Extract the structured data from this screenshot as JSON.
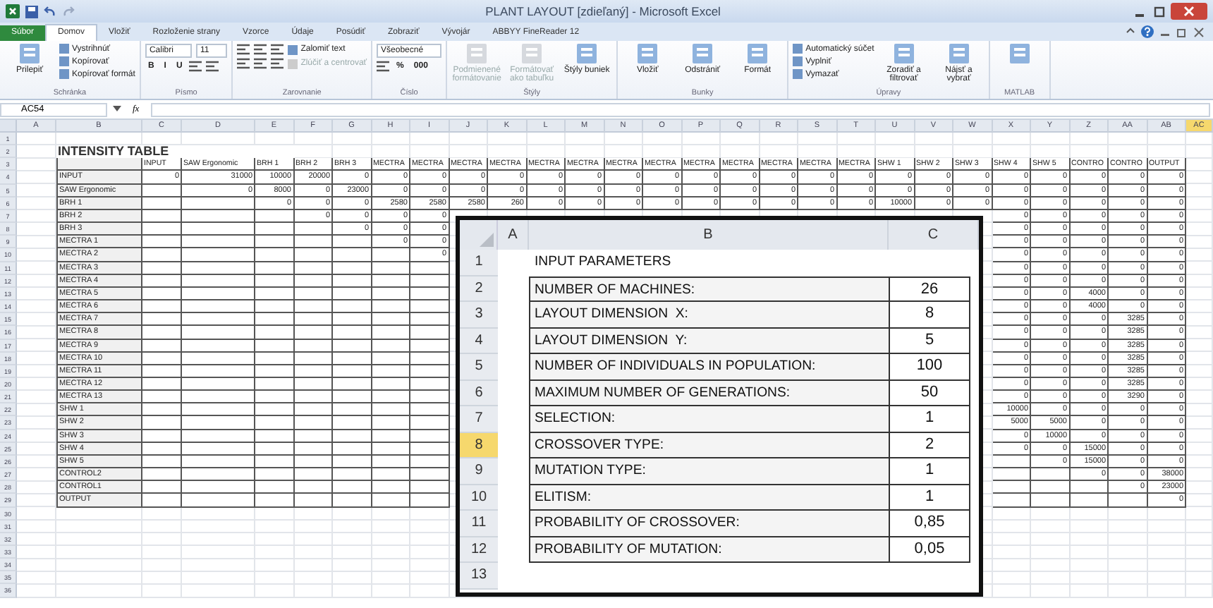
{
  "window": {
    "title": "PLANT LAYOUT [zdieľaný] - Microsoft Excel"
  },
  "tabs": [
    {
      "label": "Súbor",
      "kind": "file",
      "selected": false
    },
    {
      "label": "Domov",
      "kind": "tab",
      "selected": true
    },
    {
      "label": "Vložiť",
      "kind": "tab",
      "selected": false
    },
    {
      "label": "Rozloženie strany",
      "kind": "tab",
      "selected": false
    },
    {
      "label": "Vzorce",
      "kind": "tab",
      "selected": false
    },
    {
      "label": "Údaje",
      "kind": "tab",
      "selected": false
    },
    {
      "label": "Posúdiť",
      "kind": "tab",
      "selected": false
    },
    {
      "label": "Zobraziť",
      "kind": "tab",
      "selected": false
    },
    {
      "label": "Vývojár",
      "kind": "tab",
      "selected": false
    },
    {
      "label": "ABBYY FineReader 12",
      "kind": "tab",
      "selected": false
    }
  ],
  "ribbon": {
    "groups": [
      {
        "label": "Schránka",
        "big": [
          {
            "kind": "big",
            "text": "Prilepiť",
            "disabled": false
          }
        ],
        "stack": [
          {
            "kind": "small",
            "text": "Vystrihnúť",
            "disabled": false
          },
          {
            "kind": "small",
            "text": "Kopírovať",
            "disabled": false
          },
          {
            "kind": "small",
            "text": "Kopírovať formát",
            "disabled": false
          }
        ]
      },
      {
        "label": "Písmo",
        "font_controls": [
          {
            "kind": "field",
            "text": "Calibri",
            "disabled": false
          },
          {
            "kind": "field",
            "text": "11",
            "disabled": false
          },
          {
            "kind": "glyph",
            "text": "B",
            "disabled": false
          },
          {
            "kind": "glyph",
            "text": "I",
            "disabled": false
          },
          {
            "kind": "glyph",
            "text": "U",
            "disabled": false
          },
          {
            "kind": "icon",
            "disabled": false
          },
          {
            "kind": "icon",
            "disabled": false
          }
        ]
      },
      {
        "label": "Zarovnanie",
        "font_controls": [
          {
            "kind": "icon",
            "disabled": false
          },
          {
            "kind": "icon",
            "disabled": false
          },
          {
            "kind": "icon",
            "disabled": false
          },
          {
            "kind": "small",
            "text": "Zalomiť text",
            "disabled": false
          },
          {
            "kind": "icon",
            "disabled": false
          },
          {
            "kind": "icon",
            "disabled": false
          },
          {
            "kind": "icon",
            "disabled": false
          },
          {
            "kind": "small",
            "text": "Zlúčiť a centrovať",
            "disabled": true
          }
        ]
      },
      {
        "label": "Číslo",
        "font_controls": [
          {
            "kind": "field",
            "text": "Všeobecné",
            "disabled": false
          },
          {
            "kind": "icon",
            "disabled": false
          },
          {
            "kind": "glyph",
            "text": "%",
            "disabled": false
          },
          {
            "kind": "glyph",
            "text": "000",
            "disabled": false
          }
        ]
      },
      {
        "label": "Štýly",
        "big": [
          {
            "kind": "big",
            "text": "Podmienené formátovanie",
            "disabled": true
          },
          {
            "kind": "big",
            "text": "Formátovať ako tabuľku",
            "disabled": true
          },
          {
            "kind": "big",
            "text": "Štýly buniek",
            "disabled": false
          }
        ]
      },
      {
        "label": "Bunky",
        "big": [
          {
            "kind": "big",
            "text": "Vložiť",
            "disabled": false
          },
          {
            "kind": "big",
            "text": "Odstrániť",
            "disabled": false
          },
          {
            "kind": "big",
            "text": "Formát",
            "disabled": false
          }
        ]
      },
      {
        "label": "Úpravy",
        "stack": [
          {
            "kind": "small",
            "text": "Automatický súčet",
            "disabled": false
          },
          {
            "kind": "small",
            "text": "Vyplniť",
            "disabled": false
          },
          {
            "kind": "small",
            "text": "Vymazať",
            "disabled": false
          }
        ],
        "big_after": [
          {
            "kind": "big",
            "text": "Zoradiť a filtrovať",
            "disabled": false
          },
          {
            "kind": "big",
            "text": "Nájsť a vybrať",
            "disabled": false
          }
        ]
      },
      {
        "label": "MATLAB",
        "big": [
          {
            "kind": "big",
            "disabled": false
          }
        ]
      }
    ]
  },
  "formula_bar": {
    "name_box": "AC54",
    "function_label": "fx"
  },
  "sheet": {
    "column_letters": [
      {
        "label": "A",
        "selected": false
      },
      {
        "label": "B",
        "selected": false
      },
      {
        "label": "C",
        "selected": false
      },
      {
        "label": "D",
        "selected": false
      },
      {
        "label": "E",
        "selected": false
      },
      {
        "label": "F",
        "selected": false
      },
      {
        "label": "G",
        "selected": false
      },
      {
        "label": "H",
        "selected": false
      },
      {
        "label": "I",
        "selected": false
      },
      {
        "label": "J",
        "selected": false
      },
      {
        "label": "K",
        "selected": false
      },
      {
        "label": "L",
        "selected": false
      },
      {
        "label": "M",
        "selected": false
      },
      {
        "label": "N",
        "selected": false
      },
      {
        "label": "O",
        "selected": false
      },
      {
        "label": "P",
        "selected": false
      },
      {
        "label": "Q",
        "selected": false
      },
      {
        "label": "R",
        "selected": false
      },
      {
        "label": "S",
        "selected": false
      },
      {
        "label": "T",
        "selected": false
      },
      {
        "label": "U",
        "selected": false
      },
      {
        "label": "V",
        "selected": false
      },
      {
        "label": "W",
        "selected": false
      },
      {
        "label": "X",
        "selected": false
      },
      {
        "label": "Y",
        "selected": false
      },
      {
        "label": "Z",
        "selected": false
      },
      {
        "label": "AA",
        "selected": false
      },
      {
        "label": "AB",
        "selected": false
      },
      {
        "label": "AC",
        "selected": true
      }
    ],
    "row_numbers": [
      "1",
      "2",
      "3",
      "4",
      "5",
      "6",
      "7",
      "8",
      "9",
      "10",
      "11",
      "12",
      "13",
      "14",
      "15",
      "16",
      "17",
      "18",
      "19",
      "20",
      "21",
      "22",
      "23",
      "24",
      "25",
      "26",
      "27",
      "28",
      "29",
      "30",
      "31",
      "32",
      "33",
      "34",
      "35",
      "36"
    ],
    "intensity_table": {
      "title": "INTENSITY TABLE",
      "columns": [
        "INPUT",
        "SAW Ergonomic",
        "BRH 1",
        "BRH 2",
        "BRH 3",
        "MECTRA",
        "MECTRA",
        "MECTRA",
        "MECTRA",
        "MECTRA",
        "MECTRA",
        "MECTRA",
        "MECTRA",
        "MECTRA",
        "MECTRA",
        "MECTRA",
        "MECTRA",
        "MECTRA",
        "SHW 1",
        "SHW 2",
        "SHW 3",
        "SHW 4",
        "SHW 5",
        "CONTRO",
        "CONTRO",
        "OUTPUT"
      ],
      "rows": [
        {
          "label": "INPUT",
          "cells": [
            "0",
            "31000",
            "10000",
            "20000",
            "0",
            "0",
            "0",
            "0",
            "0",
            "0",
            "0",
            "0",
            "0",
            "0",
            "0",
            "0",
            "0",
            "0",
            "0",
            "0",
            "0",
            "0",
            "0",
            "0",
            "0",
            "0"
          ]
        },
        {
          "label": "SAW Ergonomic",
          "cells": [
            null,
            "0",
            "8000",
            "0",
            "23000",
            "0",
            "0",
            "0",
            "0",
            "0",
            "0",
            "0",
            "0",
            "0",
            "0",
            "0",
            "0",
            "0",
            "0",
            "0",
            "0",
            "0",
            "0",
            "0",
            "0",
            "0"
          ]
        },
        {
          "label": "BRH 1",
          "cells": [
            null,
            null,
            "0",
            "0",
            "0",
            "2580",
            "2580",
            "2580",
            "260",
            "0",
            "0",
            "0",
            "0",
            "0",
            "0",
            "0",
            "0",
            "0",
            "10000",
            "0",
            "0",
            "0",
            "0",
            "0",
            "0",
            "0"
          ]
        },
        {
          "label": "BRH 2",
          "cells": [
            null,
            null,
            null,
            "0",
            "0",
            "0",
            "0",
            null,
            null,
            null,
            null,
            null,
            null,
            null,
            null,
            null,
            null,
            null,
            null,
            null,
            null,
            "0",
            "0",
            "0",
            "0",
            "0"
          ]
        },
        {
          "label": "BRH 3",
          "cells": [
            null,
            null,
            null,
            null,
            "0",
            "0",
            "0",
            null,
            null,
            null,
            null,
            null,
            null,
            null,
            null,
            null,
            null,
            null,
            null,
            null,
            null,
            "0",
            "0",
            "0",
            "0",
            "0"
          ]
        },
        {
          "label": "MECTRA 1",
          "cells": [
            null,
            null,
            null,
            null,
            null,
            "0",
            "0",
            null,
            null,
            null,
            null,
            null,
            null,
            null,
            null,
            null,
            null,
            null,
            null,
            null,
            null,
            "0",
            "0",
            "0",
            "0",
            "0"
          ]
        },
        {
          "label": "MECTRA 2",
          "cells": [
            null,
            null,
            null,
            null,
            null,
            null,
            "0",
            null,
            null,
            null,
            null,
            null,
            null,
            null,
            null,
            null,
            null,
            null,
            null,
            null,
            null,
            "0",
            "0",
            "0",
            "0",
            "0"
          ]
        },
        {
          "label": "MECTRA 3",
          "cells": [
            null,
            null,
            null,
            null,
            null,
            null,
            null,
            null,
            null,
            null,
            null,
            null,
            null,
            null,
            null,
            null,
            null,
            null,
            null,
            null,
            null,
            "0",
            "0",
            "0",
            "0",
            "0"
          ]
        },
        {
          "label": "MECTRA 4",
          "cells": [
            null,
            null,
            null,
            null,
            null,
            null,
            null,
            null,
            null,
            null,
            null,
            null,
            null,
            null,
            null,
            null,
            null,
            null,
            null,
            null,
            null,
            "0",
            "0",
            "0",
            "0",
            "0"
          ]
        },
        {
          "label": "MECTRA 5",
          "cells": [
            null,
            null,
            null,
            null,
            null,
            null,
            null,
            null,
            null,
            null,
            null,
            null,
            null,
            null,
            null,
            null,
            null,
            null,
            null,
            null,
            null,
            "0",
            "0",
            "4000",
            "0",
            "0"
          ]
        },
        {
          "label": "MECTRA 6",
          "cells": [
            null,
            null,
            null,
            null,
            null,
            null,
            null,
            null,
            null,
            null,
            null,
            null,
            null,
            null,
            null,
            null,
            null,
            null,
            null,
            null,
            null,
            "0",
            "0",
            "4000",
            "0",
            "0"
          ]
        },
        {
          "label": "MECTRA 7",
          "cells": [
            null,
            null,
            null,
            null,
            null,
            null,
            null,
            null,
            null,
            null,
            null,
            null,
            null,
            null,
            null,
            null,
            null,
            null,
            null,
            null,
            null,
            "0",
            "0",
            "0",
            "3285",
            "0"
          ]
        },
        {
          "label": "MECTRA 8",
          "cells": [
            null,
            null,
            null,
            null,
            null,
            null,
            null,
            null,
            null,
            null,
            null,
            null,
            null,
            null,
            null,
            null,
            null,
            null,
            null,
            null,
            null,
            "0",
            "0",
            "0",
            "3285",
            "0"
          ]
        },
        {
          "label": "MECTRA 9",
          "cells": [
            null,
            null,
            null,
            null,
            null,
            null,
            null,
            null,
            null,
            null,
            null,
            null,
            null,
            null,
            null,
            null,
            null,
            null,
            null,
            null,
            null,
            "0",
            "0",
            "0",
            "3285",
            "0"
          ]
        },
        {
          "label": "MECTRA 10",
          "cells": [
            null,
            null,
            null,
            null,
            null,
            null,
            null,
            null,
            null,
            null,
            null,
            null,
            null,
            null,
            null,
            null,
            null,
            null,
            null,
            null,
            null,
            "0",
            "0",
            "0",
            "3285",
            "0"
          ]
        },
        {
          "label": "MECTRA 11",
          "cells": [
            null,
            null,
            null,
            null,
            null,
            null,
            null,
            null,
            null,
            null,
            null,
            null,
            null,
            null,
            null,
            null,
            null,
            null,
            null,
            null,
            null,
            "0",
            "0",
            "0",
            "3285",
            "0"
          ]
        },
        {
          "label": "MECTRA 12",
          "cells": [
            null,
            null,
            null,
            null,
            null,
            null,
            null,
            null,
            null,
            null,
            null,
            null,
            null,
            null,
            null,
            null,
            null,
            null,
            null,
            null,
            null,
            "0",
            "0",
            "0",
            "3285",
            "0"
          ]
        },
        {
          "label": "MECTRA 13",
          "cells": [
            null,
            null,
            null,
            null,
            null,
            null,
            null,
            null,
            null,
            null,
            null,
            null,
            null,
            null,
            null,
            null,
            null,
            null,
            null,
            null,
            null,
            "0",
            "0",
            "0",
            "3290",
            "0"
          ]
        },
        {
          "label": "SHW 1",
          "cells": [
            null,
            null,
            null,
            null,
            null,
            null,
            null,
            null,
            null,
            null,
            null,
            null,
            null,
            null,
            null,
            null,
            null,
            null,
            null,
            null,
            null,
            "10000",
            "0",
            "0",
            "0",
            "0"
          ]
        },
        {
          "label": "SHW 2",
          "cells": [
            null,
            null,
            null,
            null,
            null,
            null,
            null,
            null,
            null,
            null,
            null,
            null,
            null,
            null,
            null,
            null,
            null,
            null,
            null,
            null,
            null,
            "5000",
            "5000",
            "0",
            "0",
            "0"
          ]
        },
        {
          "label": "SHW 3",
          "cells": [
            null,
            null,
            null,
            null,
            null,
            null,
            null,
            null,
            null,
            null,
            null,
            null,
            null,
            null,
            null,
            null,
            null,
            null,
            null,
            null,
            null,
            "0",
            "10000",
            "0",
            "0",
            "0"
          ]
        },
        {
          "label": "SHW 4",
          "cells": [
            null,
            null,
            null,
            null,
            null,
            null,
            null,
            null,
            null,
            null,
            null,
            null,
            null,
            null,
            null,
            null,
            null,
            null,
            null,
            null,
            null,
            "0",
            "0",
            "15000",
            "0",
            "0"
          ]
        },
        {
          "label": "SHW 5",
          "cells": [
            null,
            null,
            null,
            null,
            null,
            null,
            null,
            null,
            null,
            null,
            null,
            null,
            null,
            null,
            null,
            null,
            null,
            null,
            null,
            null,
            null,
            null,
            "0",
            "15000",
            "0",
            "0"
          ]
        },
        {
          "label": "CONTROL2",
          "cells": [
            null,
            null,
            null,
            null,
            null,
            null,
            null,
            null,
            null,
            null,
            null,
            null,
            null,
            null,
            null,
            null,
            null,
            null,
            null,
            null,
            null,
            null,
            null,
            "0",
            "0",
            "38000"
          ]
        },
        {
          "label": "CONTROL1",
          "cells": [
            null,
            null,
            null,
            null,
            null,
            null,
            null,
            null,
            null,
            null,
            null,
            null,
            null,
            null,
            null,
            null,
            null,
            null,
            null,
            null,
            null,
            null,
            null,
            null,
            "0",
            "23000"
          ]
        },
        {
          "label": "OUTPUT",
          "cells": [
            null,
            null,
            null,
            null,
            null,
            null,
            null,
            null,
            null,
            null,
            null,
            null,
            null,
            null,
            null,
            null,
            null,
            null,
            null,
            null,
            null,
            null,
            null,
            null,
            null,
            "0"
          ]
        }
      ]
    }
  },
  "inset_sheet": {
    "column_letters": [
      "A",
      "B",
      "C"
    ],
    "rows": [
      {
        "number": "1",
        "selected": false,
        "kind": "title",
        "label": "INPUT PARAMETERS"
      },
      {
        "number": "2",
        "selected": false,
        "kind": "param",
        "label": "NUMBER OF MACHINES:",
        "value": "26"
      },
      {
        "number": "3",
        "selected": false,
        "kind": "param",
        "label": "LAYOUT DIMENSION  X:",
        "value": "8"
      },
      {
        "number": "4",
        "selected": false,
        "kind": "param",
        "label": "LAYOUT DIMENSION  Y:",
        "value": "5"
      },
      {
        "number": "5",
        "selected": false,
        "kind": "param",
        "label": "NUMBER OF INDIVIDUALS IN POPULATION:",
        "value": "100"
      },
      {
        "number": "6",
        "selected": false,
        "kind": "param",
        "label": "MAXIMUM NUMBER OF GENERATIONS:",
        "value": "50"
      },
      {
        "number": "7",
        "selected": false,
        "kind": "param",
        "label": "SELECTION:",
        "value": "1"
      },
      {
        "number": "8",
        "selected": true,
        "kind": "param",
        "label": "CROSSOVER TYPE:",
        "value": "2"
      },
      {
        "number": "9",
        "selected": false,
        "kind": "param",
        "label": "MUTATION TYPE:",
        "value": "1"
      },
      {
        "number": "10",
        "selected": false,
        "kind": "param",
        "label": "ELITISM:",
        "value": "1"
      },
      {
        "number": "11",
        "selected": false,
        "kind": "param",
        "label": "PROBABILITY OF CROSSOVER:",
        "value": "0,85"
      },
      {
        "number": "12",
        "selected": false,
        "kind": "param",
        "label": "PROBABILITY OF MUTATION:",
        "value": "0,05"
      },
      {
        "number": "13",
        "selected": false,
        "kind": "empty"
      }
    ]
  }
}
